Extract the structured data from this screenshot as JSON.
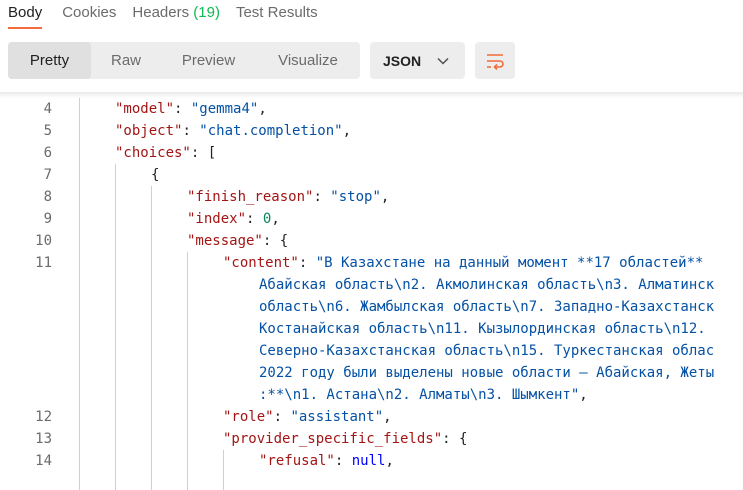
{
  "tabs": [
    {
      "label": "Body",
      "count": ""
    },
    {
      "label": "Cookies",
      "count": ""
    },
    {
      "label": "Headers",
      "count": "(19)"
    },
    {
      "label": "Test Results",
      "count": ""
    }
  ],
  "view_modes": [
    "Pretty",
    "Raw",
    "Preview",
    "Visualize"
  ],
  "format": {
    "selected": "JSON"
  },
  "colors": {
    "accent": "#f26b3a",
    "count_green": "#0cbb52",
    "key": "#a31515",
    "string": "#0451a5",
    "number": "#098658",
    "keyword": "#0000ff"
  },
  "icons": {
    "format_dropdown": "chevron-down-icon",
    "wrap": "wrap-lines-icon"
  },
  "lines": [
    {
      "num": "4",
      "segments": [
        [
          "k",
          "\"model\""
        ],
        [
          "p",
          ": "
        ],
        [
          "s",
          "\"gemma4\""
        ],
        [
          "p",
          ","
        ]
      ]
    },
    {
      "num": "5",
      "segments": [
        [
          "k",
          "\"object\""
        ],
        [
          "p",
          ": "
        ],
        [
          "s",
          "\"chat.completion\""
        ],
        [
          "p",
          ","
        ]
      ]
    },
    {
      "num": "6",
      "segments": [
        [
          "k",
          "\"choices\""
        ],
        [
          "p",
          ": ["
        ]
      ]
    },
    {
      "num": "7",
      "segments": [
        [
          "p",
          "{"
        ]
      ]
    },
    {
      "num": "8",
      "segments": [
        [
          "k",
          "\"finish_reason\""
        ],
        [
          "p",
          ": "
        ],
        [
          "s",
          "\"stop\""
        ],
        [
          "p",
          ","
        ]
      ]
    },
    {
      "num": "9",
      "segments": [
        [
          "k",
          "\"index\""
        ],
        [
          "p",
          ": "
        ],
        [
          "n",
          "0"
        ],
        [
          "p",
          ","
        ]
      ]
    },
    {
      "num": "10",
      "segments": [
        [
          "k",
          "\"message\""
        ],
        [
          "p",
          ": {"
        ]
      ]
    },
    {
      "num": "11",
      "segments": [
        [
          "k",
          "\"content\""
        ],
        [
          "p",
          ": "
        ],
        [
          "s",
          "\"В Казахстане на данный момент **17 областей**"
        ]
      ]
    },
    {
      "num": "",
      "segments": [
        [
          "s",
          "Абайская область\\n2. Акмолинская область\\n3. Алматинск"
        ]
      ]
    },
    {
      "num": "",
      "segments": [
        [
          "s",
          "область\\n6. Жамбылская область\\n7. Западно-Казахстанск"
        ]
      ]
    },
    {
      "num": "",
      "segments": [
        [
          "s",
          "Костанайская область\\n11. Кызылординская область\\n12."
        ]
      ]
    },
    {
      "num": "",
      "segments": [
        [
          "s",
          "Северно-Казахстанская область\\n15. Туркестанская облас"
        ]
      ]
    },
    {
      "num": "",
      "segments": [
        [
          "s",
          "2022 году были выделены новые области — Абайская, Жеты"
        ]
      ]
    },
    {
      "num": "",
      "segments": [
        [
          "s",
          ":**\\n1. Астана\\n2. Алматы\\n3. Шымкент\""
        ],
        [
          "p",
          ","
        ]
      ]
    },
    {
      "num": "12",
      "segments": [
        [
          "k",
          "\"role\""
        ],
        [
          "p",
          ": "
        ],
        [
          "s",
          "\"assistant\""
        ],
        [
          "p",
          ","
        ]
      ]
    },
    {
      "num": "13",
      "segments": [
        [
          "k",
          "\"provider_specific_fields\""
        ],
        [
          "p",
          ": {"
        ]
      ]
    },
    {
      "num": "14",
      "segments": [
        [
          "k",
          "\"refusal\""
        ],
        [
          "p",
          ": "
        ],
        [
          "kw",
          "null"
        ],
        [
          "p",
          ","
        ]
      ]
    }
  ]
}
